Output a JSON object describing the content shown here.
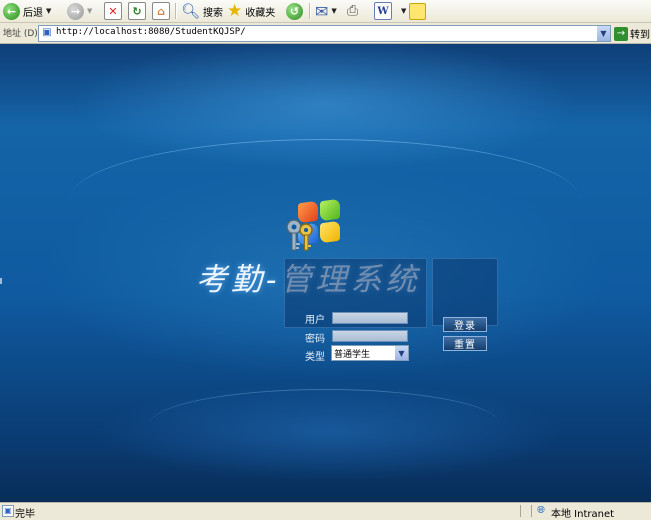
{
  "toolbar": {
    "back_label": "后退",
    "search_label": "搜索",
    "favorites_label": "收藏夹"
  },
  "address_bar": {
    "label": "地址 (D)",
    "url": "http://localhost:8080/StudentKQJSP/",
    "go_label": "转到"
  },
  "page": {
    "title": "考勤-管理系统",
    "user_label": "用户",
    "user_value": "",
    "password_label": "密码",
    "password_value": "",
    "type_label": "类型",
    "type_selected": "普通学生",
    "login_button": "登录",
    "reset_button": "重置"
  },
  "status_bar": {
    "status_text": "完毕",
    "zone_text": "本地 Intranet"
  },
  "colors": {
    "page_bg_dark": "#0a3a70",
    "page_bg_light": "#1464a8",
    "title_text": "#eef6ff",
    "button_bg": "#1f4d82"
  }
}
